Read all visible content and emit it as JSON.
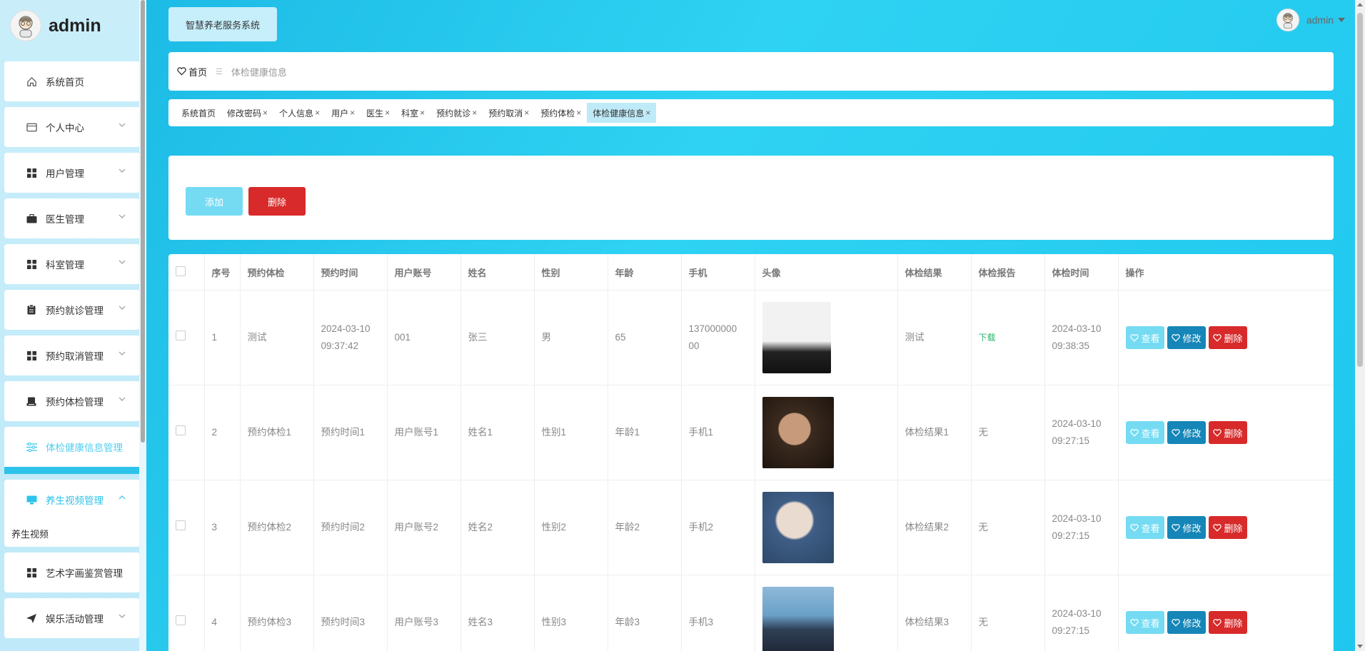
{
  "sidebar": {
    "brand": "admin",
    "items": [
      {
        "label": "系统首页",
        "icon": "home-icon"
      },
      {
        "label": "个人中心",
        "icon": "card-icon"
      },
      {
        "label": "用户管理",
        "icon": "grid-icon"
      },
      {
        "label": "医生管理",
        "icon": "briefcase-icon"
      },
      {
        "label": "科室管理",
        "icon": "grid-icon"
      },
      {
        "label": "预约就诊管理",
        "icon": "clipboard-icon"
      },
      {
        "label": "预约取消管理",
        "icon": "grid-icon"
      },
      {
        "label": "预约体检管理",
        "icon": "printer-icon"
      },
      {
        "label": "体检健康信息管理",
        "icon": "sliders-icon"
      },
      {
        "label": "养生视频管理",
        "icon": "monitor-icon",
        "sub": "养生视频"
      },
      {
        "label": "艺术字画鉴赏管理",
        "icon": "grid-icon"
      },
      {
        "label": "娱乐活动管理",
        "icon": "send-icon"
      }
    ]
  },
  "header": {
    "system_title": "智慧养老服务系统",
    "user": "admin"
  },
  "breadcrumb": {
    "home": "首页",
    "current": "体检健康信息"
  },
  "tags": [
    "系统首页",
    "修改密码",
    "个人信息",
    "用户",
    "医生",
    "科室",
    "预约就诊",
    "预约取消",
    "预约体检",
    "体检健康信息"
  ],
  "toolbar": {
    "add": "添加",
    "delete": "删除"
  },
  "table": {
    "headers": [
      "序号",
      "预约体检",
      "预约时间",
      "用户账号",
      "姓名",
      "性别",
      "年龄",
      "手机",
      "头像",
      "体检结果",
      "体检报告",
      "体检时间",
      "操作"
    ],
    "rows": [
      {
        "no": "1",
        "exam": "测试",
        "time1": "2024-03-10",
        "time2": "09:37:42",
        "account": "001",
        "name": "张三",
        "gender": "男",
        "age": "65",
        "phone1": "137000000",
        "phone2": "00",
        "result": "测试",
        "report": "下载",
        "etime1": "2024-03-10",
        "etime2": "09:38:35"
      },
      {
        "no": "2",
        "exam": "预约体检1",
        "time1": "预约时间1",
        "time2": "",
        "account": "用户账号1",
        "name": "姓名1",
        "gender": "性别1",
        "age": "年龄1",
        "phone1": "手机1",
        "phone2": "",
        "result": "体检结果1",
        "report": "无",
        "etime1": "2024-03-10",
        "etime2": "09:27:15"
      },
      {
        "no": "3",
        "exam": "预约体检2",
        "time1": "预约时间2",
        "time2": "",
        "account": "用户账号2",
        "name": "姓名2",
        "gender": "性别2",
        "age": "年龄2",
        "phone1": "手机2",
        "phone2": "",
        "result": "体检结果2",
        "report": "无",
        "etime1": "2024-03-10",
        "etime2": "09:27:15"
      },
      {
        "no": "4",
        "exam": "预约体检3",
        "time1": "预约时间3",
        "time2": "",
        "account": "用户账号3",
        "name": "姓名3",
        "gender": "性别3",
        "age": "年龄3",
        "phone1": "手机3",
        "phone2": "",
        "result": "体检结果3",
        "report": "无",
        "etime1": "2024-03-10",
        "etime2": "09:27:15"
      }
    ],
    "ops": {
      "view": "查看",
      "edit": "修改",
      "delete": "删除"
    }
  },
  "colors": {
    "accent": "#2ec3ea",
    "danger": "#d82a2a",
    "edit": "#1586b7",
    "download": "#2ab56b"
  }
}
